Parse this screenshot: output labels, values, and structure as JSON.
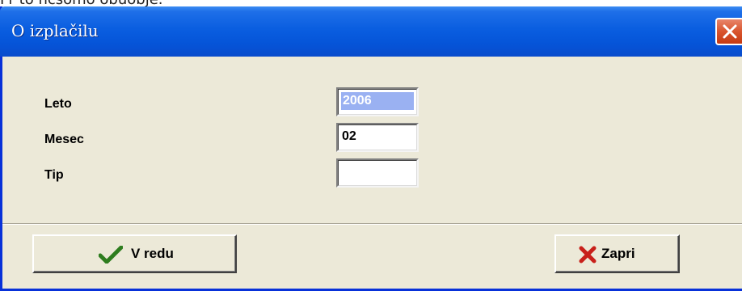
{
  "background": {
    "caption": "Pr to  ncsomo obuobje."
  },
  "window": {
    "title": "O izplačilu",
    "close_icon": "close-icon"
  },
  "form": {
    "fields": [
      {
        "label": "Leto",
        "value": "2006",
        "selected": true
      },
      {
        "label": "Mesec",
        "value": "02",
        "selected": false
      },
      {
        "label": "Tip",
        "value": "",
        "selected": false
      }
    ]
  },
  "buttons": {
    "ok": {
      "label": "V redu",
      "icon": "checkmark-icon",
      "icon_color": "#2e7d1f"
    },
    "close": {
      "label": "Zapri",
      "icon": "x-icon",
      "icon_color": "#c8201a"
    }
  },
  "colors": {
    "titlebar": "#0554d8",
    "dialog_bg": "#ece9d8",
    "selection": "#9ab1f2",
    "close_button": "#d9542d"
  }
}
